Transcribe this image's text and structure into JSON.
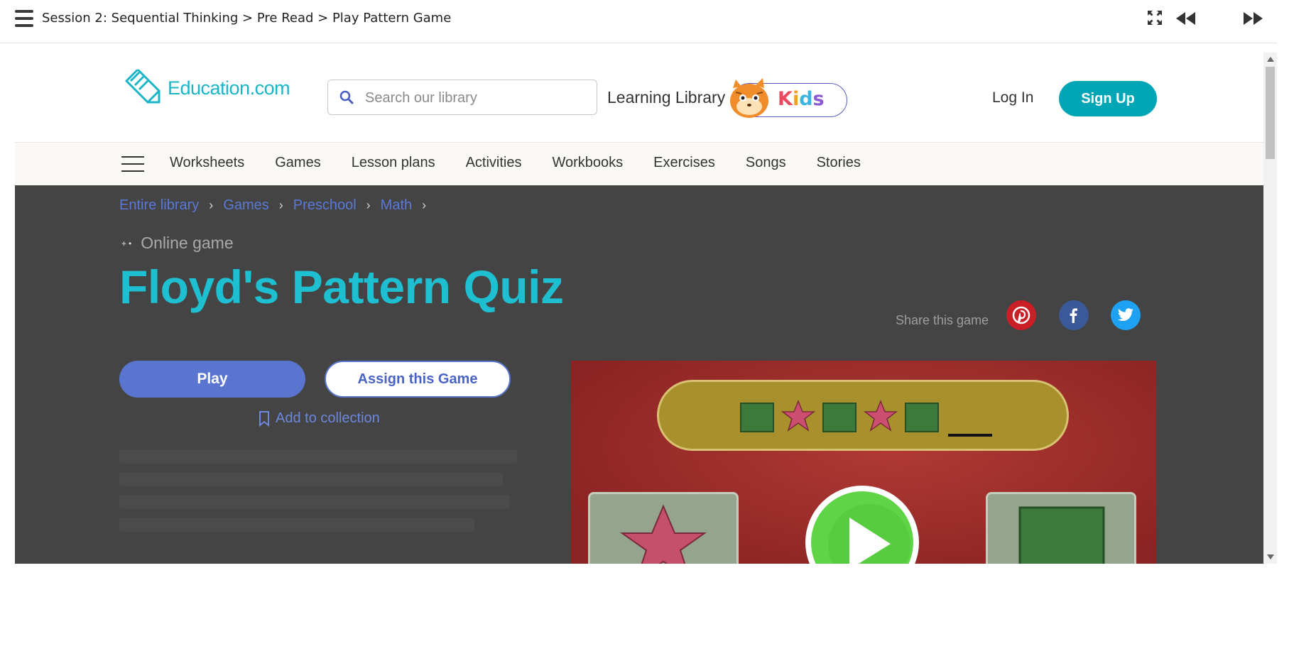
{
  "session_bar": {
    "breadcrumb": "Session 2: Sequential Thinking > Pre Read > Play Pattern Game"
  },
  "header": {
    "logo_text": "Education.com",
    "search_placeholder": "Search our library",
    "learning_library": "Learning Library",
    "kids_badge": [
      "K",
      "i",
      "d",
      "s"
    ],
    "login": "Log In",
    "signup": "Sign Up"
  },
  "nav": {
    "items": [
      "Worksheets",
      "Games",
      "Lesson plans",
      "Activities",
      "Workbooks",
      "Exercises",
      "Songs",
      "Stories"
    ]
  },
  "breadcrumb": {
    "items": [
      "Entire library",
      "Games",
      "Preschool",
      "Math"
    ]
  },
  "game": {
    "type": "Online game",
    "title": "Floyd's Pattern Quiz",
    "share_label": "Share this game",
    "play_label": "Play",
    "assign_label": "Assign this Game",
    "add_collection": "Add to collection"
  },
  "colors": {
    "accent_teal": "#1ebfd0",
    "button_blue": "#5a75cf",
    "signup_teal": "#00a6b6",
    "hero_bg": "#444444",
    "pinterest": "#cb1f27",
    "facebook": "#3b5998",
    "twitter": "#1da1f2"
  }
}
